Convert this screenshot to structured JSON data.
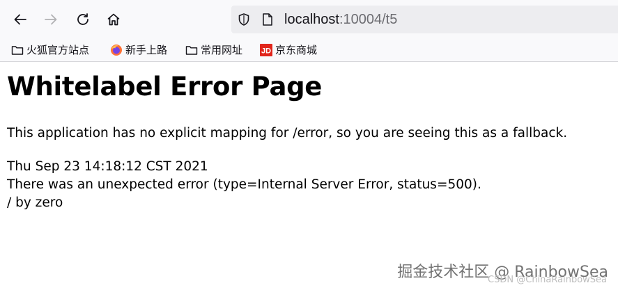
{
  "browser": {
    "nav": {
      "back_icon": "arrow-left-icon",
      "forward_icon": "arrow-right-icon",
      "reload_icon": "reload-icon",
      "home_icon": "home-icon"
    },
    "url": {
      "host": "localhost",
      "rest": ":10004/t5"
    },
    "bookmarks": [
      {
        "label": "火狐官方站点",
        "icon": "folder-icon"
      },
      {
        "label": "新手上路",
        "icon": "firefox-icon"
      },
      {
        "label": "常用网址",
        "icon": "folder-icon"
      },
      {
        "label": "京东商城",
        "icon": "jd-icon",
        "icon_text": "JD",
        "color": "#e1251b"
      }
    ]
  },
  "page": {
    "title": "Whitelabel Error Page",
    "message": "This application has no explicit mapping for /error, so you are seeing this as a fallback.",
    "timestamp": "Thu Sep 23 14:18:12 CST 2021",
    "error_line": "There was an unexpected error (type=Internal Server Error, status=500).",
    "detail": "/ by zero"
  },
  "watermark": {
    "main": "掘金技术社区 @ RainbowSea",
    "small": "CSDN @ChinaRainbowSea"
  }
}
